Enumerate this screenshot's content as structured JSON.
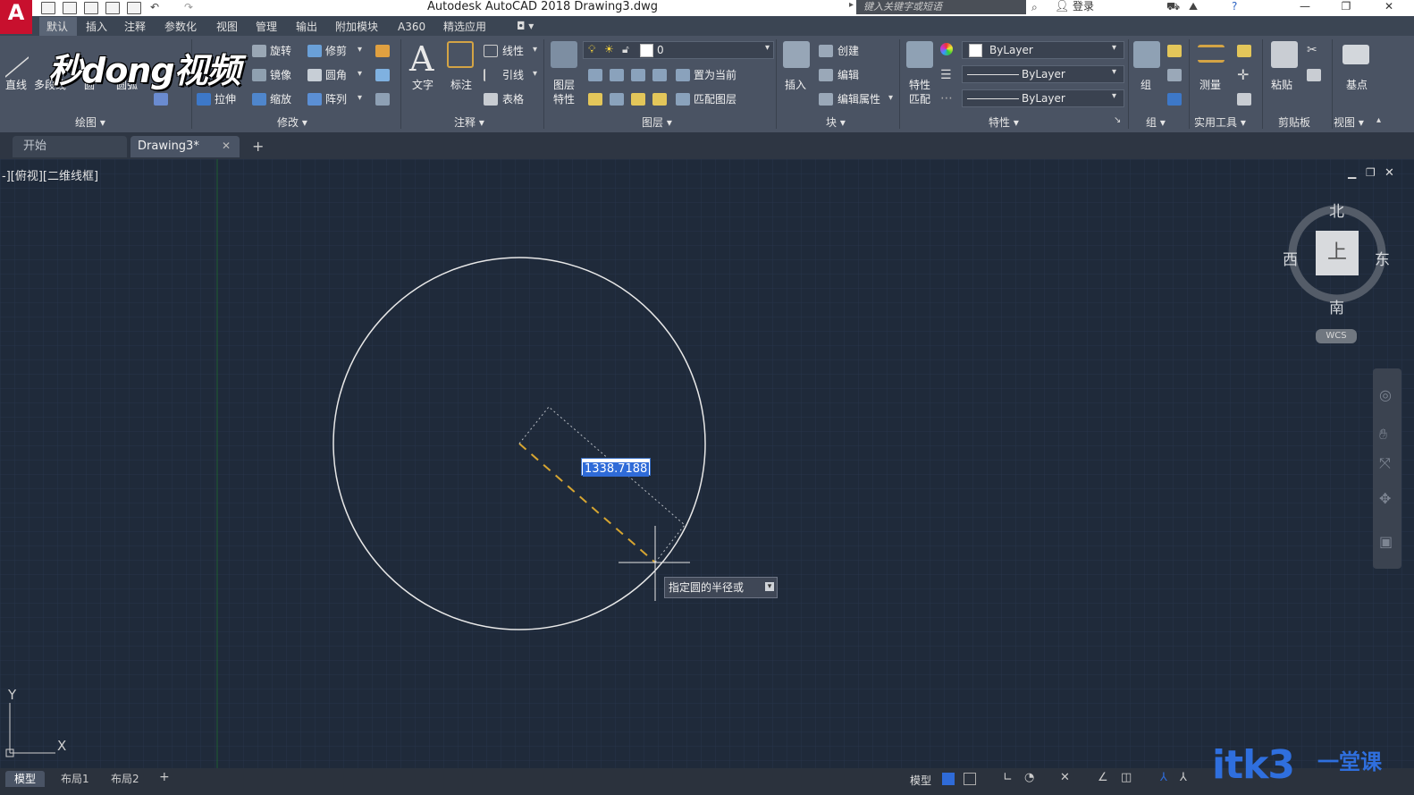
{
  "titlebar": {
    "title": "Autodesk AutoCAD 2018    Drawing3.dwg",
    "search_placeholder": "键入关键字或短语",
    "login": "登录",
    "app_letter": "A"
  },
  "ribbon_tabs": [
    "默认",
    "插入",
    "注释",
    "参数化",
    "视图",
    "管理",
    "输出",
    "附加模块",
    "A360",
    "精选应用"
  ],
  "panels": {
    "draw": {
      "title": "绘图 ▾",
      "line": "直线",
      "polyline": "多段线",
      "circle": "圆",
      "arc": "圆弧"
    },
    "modify": {
      "title": "修改 ▾",
      "rotate": "旋转",
      "trim": "修剪",
      "mirror": "镜像",
      "fillet": "圆角",
      "stretch": "拉伸",
      "scale": "缩放",
      "array": "阵列"
    },
    "annotation": {
      "title": "注释 ▾",
      "text": "文字",
      "dimension": "标注",
      "linear": "线性",
      "leader": "引线",
      "table": "表格"
    },
    "layers": {
      "title": "图层 ▾",
      "layer_props_1": "图层",
      "layer_props_2": "特性",
      "layer_value": "0",
      "set_current": "置为当前",
      "match_layer": "匹配图层"
    },
    "block": {
      "title": "块 ▾",
      "insert": "插入",
      "create": "创建",
      "edit": "编辑",
      "edit_attr": "编辑属性"
    },
    "properties": {
      "title": "特性 ▾",
      "match_1": "特性",
      "match_2": "匹配",
      "color": "ByLayer",
      "linetype": "ByLayer",
      "lineweight": "ByLayer"
    },
    "groups": {
      "title": "组 ▾",
      "group": "组"
    },
    "utilities": {
      "title": "实用工具 ▾",
      "measure": "测量"
    },
    "clipboard": {
      "title": "剪贴板",
      "paste": "粘贴"
    },
    "view": {
      "title": "视图 ▾",
      "base": "基点"
    }
  },
  "doc_tabs": {
    "start": "开始",
    "drawing": "Drawing3*"
  },
  "viewport": {
    "label": "-][俯视][二维线框]"
  },
  "command": {
    "dynamic_input_value": "1338.7188",
    "prompt": "指定圆的半径或"
  },
  "viewcube": {
    "top": "上",
    "north": "北",
    "south": "南",
    "east": "东",
    "west": "西",
    "wcs": "WCS"
  },
  "ucs": {
    "x": "X",
    "y": "Y"
  },
  "layout_tabs": [
    "模型",
    "布局1",
    "布局2"
  ],
  "status": {
    "model": "模型"
  },
  "watermarks": {
    "top_left": "秒dong视频",
    "bottom_right": "itk3",
    "bottom_right_cn": "一堂课"
  },
  "colors": {
    "canvas_bg": "#1f2a3a",
    "ribbon_bg": "#4a5363",
    "accent_blue": "#2f6bd8",
    "logo_red": "#c8102e"
  }
}
